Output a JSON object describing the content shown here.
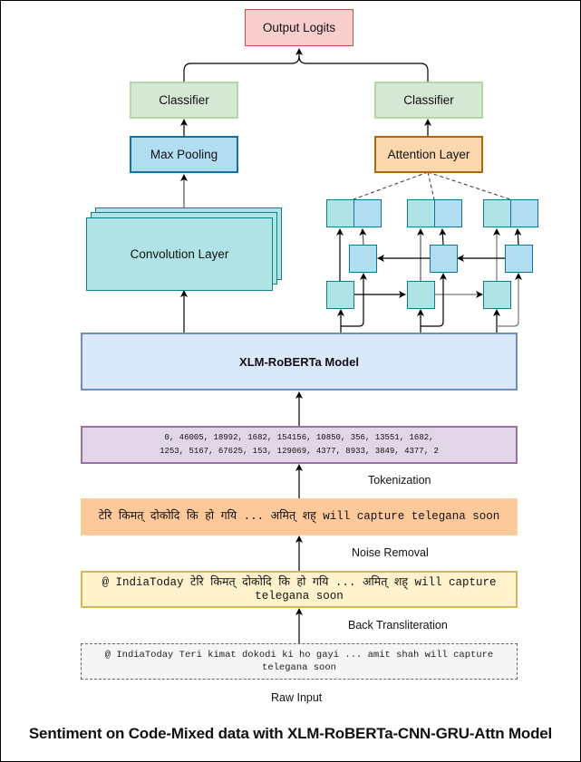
{
  "diagram": {
    "title": "Sentiment on Code-Mixed data with XLM-RoBERTa-CNN-GRU-Attn Model",
    "nodes": {
      "output_logits": "Output Logits",
      "classifier_left": "Classifier",
      "classifier_right": "Classifier",
      "max_pooling": "Max Pooling",
      "attention_layer": "Attention Layer",
      "convolution_layer": "Convolution Layer",
      "xlm_roberta": "XLM-RoBERTa Model",
      "token_ids_line1": "0, 46005, 18992, 1682, 154156, 10850, 356, 13551, 1682,",
      "token_ids_line2": "1253, 5167, 67625, 153, 129069, 4377, 8933, 3849, 4377, 2",
      "noise_removed_text": "टेरि किमत् दोकोदि कि हो गयि ... अमित् शह् will capture telegana soon",
      "transliterated_text": "@ IndiaToday टेरि किमत् दोकोदि कि हो गयि ... अमित् शह् will capture telegana soon",
      "raw_input_text": "@ IndiaToday Teri kimat dokodi ki ho gayi ... amit shah will capture telegana soon"
    },
    "edge_labels": {
      "tokenization": "Tokenization",
      "noise_removal": "Noise Removal",
      "back_transliteration": "Back Transliteration",
      "raw_input": "Raw Input"
    },
    "gru": {
      "timesteps": 3,
      "directions": [
        "forward",
        "backward"
      ]
    }
  }
}
